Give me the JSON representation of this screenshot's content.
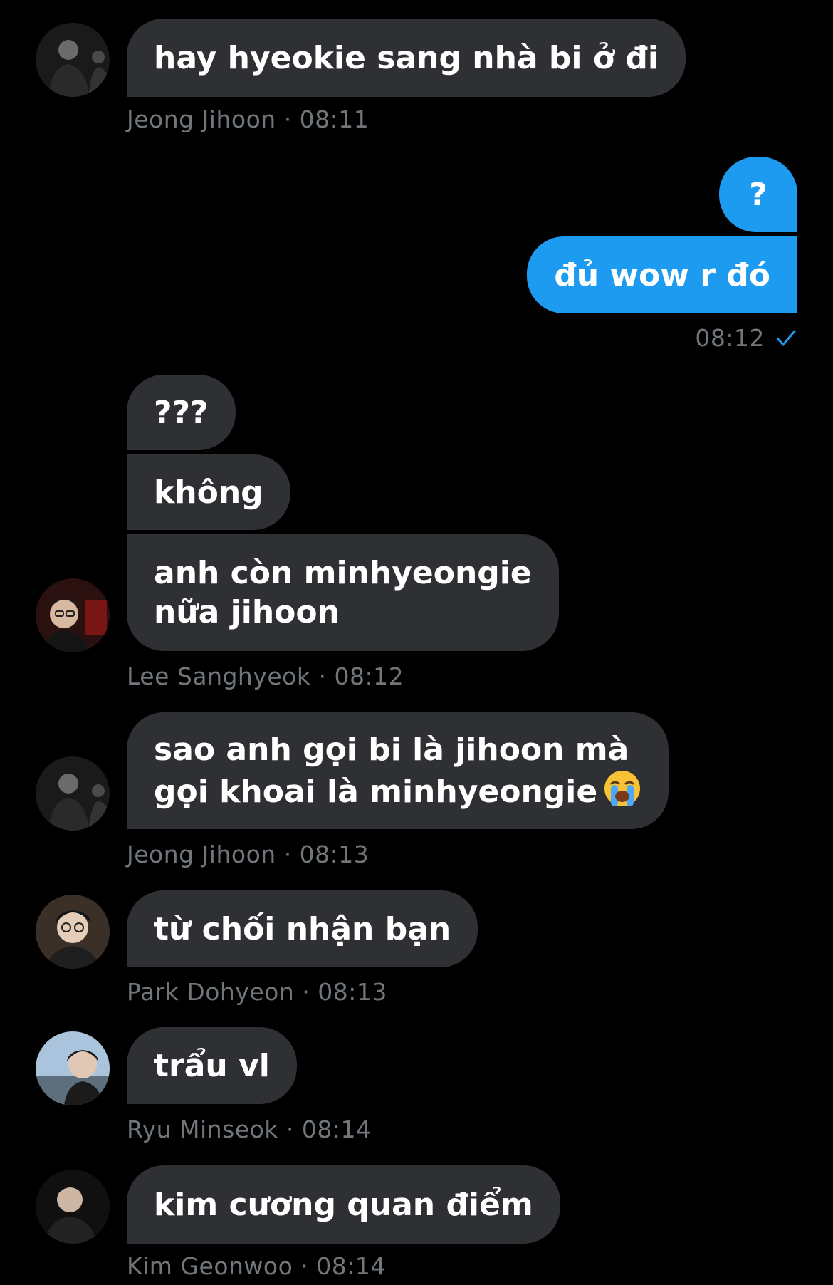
{
  "colors": {
    "background": "#000000",
    "incoming_bubble": "#2f3033",
    "outgoing_bubble": "#1d9bf0",
    "meta_text": "#71767b",
    "check": "#1d9bf0"
  },
  "messages": [
    {
      "sender": "Jeong Jihoon",
      "text": "hay hyeokie sang nhà bi ở đi",
      "meta_name": "Jeong Jihoon",
      "meta_time": "· 08:11",
      "avatar": "avatar-jeong-jihoon"
    },
    {
      "sender": "me",
      "lines": [
        "?",
        "đủ wow r đó"
      ],
      "meta_time": "08:12",
      "status_icon": "checkmark-icon"
    },
    {
      "sender": "Lee Sanghyeok",
      "lines": [
        "???",
        "không",
        "anh còn minhyeongie",
        "nữa jihoon"
      ],
      "meta_name": "Lee Sanghyeok",
      "meta_time": "· 08:12",
      "avatar": "avatar-lee-sanghyeok"
    },
    {
      "sender": "Jeong Jihoon",
      "lines": [
        "sao anh gọi bi là jihoon mà",
        "gọi khoai là minhyeongie"
      ],
      "emoji": "loudly-crying-face",
      "meta_name": "Jeong Jihoon",
      "meta_time": "· 08:13",
      "avatar": "avatar-jeong-jihoon"
    },
    {
      "sender": "Park Dohyeon",
      "text": "từ chối nhận bạn",
      "meta_name": "Park Dohyeon",
      "meta_time": "· 08:13",
      "avatar": "avatar-park-dohyeon"
    },
    {
      "sender": "Ryu Minseok",
      "text": "trẩu vl",
      "meta_name": "Ryu Minseok",
      "meta_time": "· 08:14",
      "avatar": "avatar-ryu-minseok"
    },
    {
      "sender": "Kim Geonwoo",
      "text": "kim cương quan điểm",
      "meta_name": "Kim Geonwoo",
      "meta_time": "· 08:14",
      "avatar": "avatar-kim-geonwoo"
    }
  ]
}
